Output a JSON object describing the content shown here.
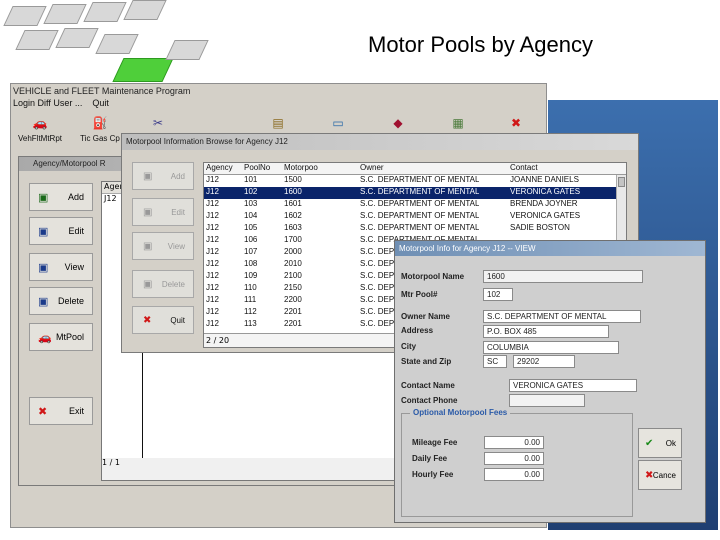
{
  "slide_title": "Motor Pools by Agency",
  "app": {
    "title": "VEHICLE and FLEET Maintenance Program",
    "menu": [
      "Login Diff User ...",
      "Quit"
    ],
    "toolbar": [
      {
        "label": "VehFltMtRpt",
        "icon": "car-icon"
      },
      {
        "label": "Tic Gas Cp",
        "icon": "gas-pump-icon"
      },
      {
        "label": "",
        "icon": "tools-icon"
      },
      {
        "label": "",
        "icon": "document-icon"
      },
      {
        "label": "",
        "icon": "monitor-icon"
      },
      {
        "label": "",
        "icon": "badge-icon"
      },
      {
        "label": "",
        "icon": "report-icon"
      },
      {
        "label": "",
        "icon": "close-x-icon"
      }
    ]
  },
  "agency_window": {
    "title": "Agency/Motorpool R",
    "buttons": [
      "Add",
      "Edit",
      "View",
      "Delete",
      "MtPool",
      "Exit"
    ],
    "grid_header": "Agenc",
    "grid_first": "J12",
    "grid_footer": "1 / 1"
  },
  "browse": {
    "title": "Motorpool Information Browse for Agency J12",
    "buttons": [
      "Add",
      "Edit",
      "View",
      "Delete",
      "Quit"
    ],
    "columns": [
      "Agency",
      "PoolNo",
      "Motorpoo",
      "Owner",
      "Contact"
    ],
    "rows": [
      [
        "J12",
        "101",
        "1500",
        "S.C. DEPARTMENT OF MENTAL",
        "JOANNE DANIELS"
      ],
      [
        "J12",
        "102",
        "1600",
        "S.C. DEPARTMENT OF MENTAL",
        "VERONICA GATES"
      ],
      [
        "J12",
        "103",
        "1601",
        "S.C. DEPARTMENT OF MENTAL",
        "BRENDA JOYNER"
      ],
      [
        "J12",
        "104",
        "1602",
        "S.C. DEPARTMENT OF MENTAL",
        "VERONICA GATES"
      ],
      [
        "J12",
        "105",
        "1603",
        "S.C. DEPARTMENT OF MENTAL",
        "SADIE BOSTON"
      ],
      [
        "J12",
        "106",
        "1700",
        "S.C. DEPARTMENT OF MENTAL",
        ""
      ],
      [
        "J12",
        "107",
        "2000",
        "S.C. DEP",
        ""
      ],
      [
        "J12",
        "108",
        "2010",
        "S.C. DEP",
        ""
      ],
      [
        "J12",
        "109",
        "2100",
        "S.C. DEP",
        ""
      ],
      [
        "J12",
        "110",
        "2150",
        "S.C. DEP",
        ""
      ],
      [
        "J12",
        "111",
        "2200",
        "S.C. DEP",
        ""
      ],
      [
        "J12",
        "112",
        "2201",
        "S.C. DEP",
        ""
      ],
      [
        "J12",
        "113",
        "2201",
        "S.C. DEP",
        ""
      ]
    ],
    "selected_row": 1,
    "footer": "2 / 20"
  },
  "info": {
    "title": "Motorpool Info for Agency J12  --  VIEW",
    "motorpool_name_label": "Motorpool Name",
    "motorpool_name": "1600",
    "mtr_pool_label": "Mtr Pool#",
    "mtr_pool": "102",
    "owner_name_label": "Owner Name",
    "owner_name": "S.C. DEPARTMENT OF MENTAL",
    "address_label": "Address",
    "address": "P.O. BOX 485",
    "city_label": "City",
    "city": "COLUMBIA",
    "state_zip_label": "State and Zip",
    "state": "SC",
    "zip": "29202",
    "contact_name_label": "Contact Name",
    "contact_name": "VERONICA GATES",
    "contact_phone_label": "Contact Phone",
    "contact_phone": "",
    "fees_group": "Optional Motorpool Fees",
    "mileage_label": "Mileage Fee",
    "mileage": "0.00",
    "daily_label": "Daily Fee",
    "daily": "0.00",
    "hourly_label": "Hourly Fee",
    "hourly": "0.00",
    "ok_label": "Ok",
    "cancel_label": "Cance"
  }
}
